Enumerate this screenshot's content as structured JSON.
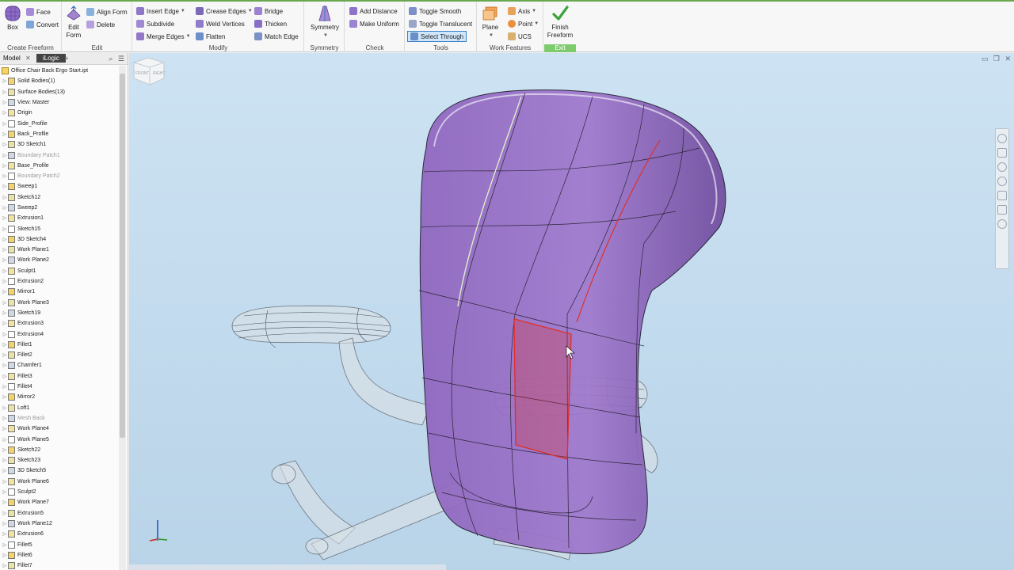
{
  "ribbon": {
    "create_freeform": {
      "label": "Create Freeform",
      "box": "Box",
      "face": "Face",
      "convert": "Convert"
    },
    "edit": {
      "label": "Edit",
      "edit_form": "Edit Form",
      "align_form": "Align Form",
      "delete": "Delete"
    },
    "modify": {
      "label": "Modify",
      "insert_edge": "Insert Edge",
      "subdivide": "Subdivide",
      "merge_edges": "Merge Edges",
      "crease_edges": "Crease Edges",
      "weld_vertices": "Weld Vertices",
      "flatten": "Flatten",
      "bridge": "Bridge",
      "thicken": "Thicken",
      "match_edge": "Match Edge"
    },
    "symmetry": {
      "label": "Symmetry",
      "symmetry": "Symmetry"
    },
    "check": {
      "label": "Check",
      "add_distance": "Add Distance",
      "make_uniform": "Make Uniform"
    },
    "tools": {
      "label": "Tools",
      "toggle_smooth": "Toggle Smooth",
      "toggle_translucent": "Toggle Translucent",
      "select_through": "Select Through"
    },
    "work_features": {
      "label": "Work Features",
      "plane": "Plane",
      "axis": "Axis",
      "point": "Point",
      "ucs": "UCS"
    },
    "exit": {
      "label": "Exit",
      "finish_freeform": "Finish Freeform"
    }
  },
  "browser": {
    "tab_model": "Model",
    "tab_ilogic": "iLogic",
    "root": "Office Chair Back Ergo Start.ipt",
    "items": [
      {
        "label": "Solid Bodies(1)",
        "dim": false
      },
      {
        "label": "Surface Bodies(13)",
        "dim": false
      },
      {
        "label": "View: Master",
        "dim": false
      },
      {
        "label": "Origin",
        "dim": false
      },
      {
        "label": "Side_Profile",
        "dim": false
      },
      {
        "label": "Back_Profile",
        "dim": false
      },
      {
        "label": "3D Sketch1",
        "dim": false
      },
      {
        "label": "Boundary Patch1",
        "dim": true
      },
      {
        "label": "Base_Profile",
        "dim": false
      },
      {
        "label": "Boundary Patch2",
        "dim": true
      },
      {
        "label": "Sweep1",
        "dim": false
      },
      {
        "label": "Sketch12",
        "dim": false
      },
      {
        "label": "Sweep2",
        "dim": false
      },
      {
        "label": "Extrusion1",
        "dim": false
      },
      {
        "label": "Sketch15",
        "dim": false
      },
      {
        "label": "3D Sketch4",
        "dim": false
      },
      {
        "label": "Work Plane1",
        "dim": false
      },
      {
        "label": "Work Plane2",
        "dim": false
      },
      {
        "label": "Sculpt1",
        "dim": false
      },
      {
        "label": "Extrusion2",
        "dim": false
      },
      {
        "label": "Mirror1",
        "dim": false
      },
      {
        "label": "Work Plane3",
        "dim": false
      },
      {
        "label": "Sketch19",
        "dim": false
      },
      {
        "label": "Extrusion3",
        "dim": false
      },
      {
        "label": "Extrusion4",
        "dim": false
      },
      {
        "label": "Fillet1",
        "dim": false
      },
      {
        "label": "Fillet2",
        "dim": false
      },
      {
        "label": "Chamfer1",
        "dim": false
      },
      {
        "label": "Fillet3",
        "dim": false
      },
      {
        "label": "Fillet4",
        "dim": false
      },
      {
        "label": "Mirror2",
        "dim": false
      },
      {
        "label": "Loft1",
        "dim": false
      },
      {
        "label": "Mesh Back",
        "dim": true
      },
      {
        "label": "Work Plane4",
        "dim": false
      },
      {
        "label": "Work Plane5",
        "dim": false
      },
      {
        "label": "Sketch22",
        "dim": false
      },
      {
        "label": "Sketch23",
        "dim": false
      },
      {
        "label": "3D Sketch5",
        "dim": false
      },
      {
        "label": "Work Plane6",
        "dim": false
      },
      {
        "label": "Sculpt2",
        "dim": false
      },
      {
        "label": "Work Plane7",
        "dim": false
      },
      {
        "label": "Extrusion5",
        "dim": false
      },
      {
        "label": "Work Plane12",
        "dim": false
      },
      {
        "label": "Extrusion6",
        "dim": false
      },
      {
        "label": "Fillet5",
        "dim": false
      },
      {
        "label": "Fillet6",
        "dim": false
      },
      {
        "label": "Fillet7",
        "dim": false
      }
    ]
  },
  "viewcube": {
    "front": "FRONT",
    "right": "RIGHT"
  },
  "colors": {
    "viewport_bg": "#c4dcef",
    "freeform_body": "#9a6fc4",
    "selection": "#e0302a",
    "finish_check": "#3aa33a"
  }
}
